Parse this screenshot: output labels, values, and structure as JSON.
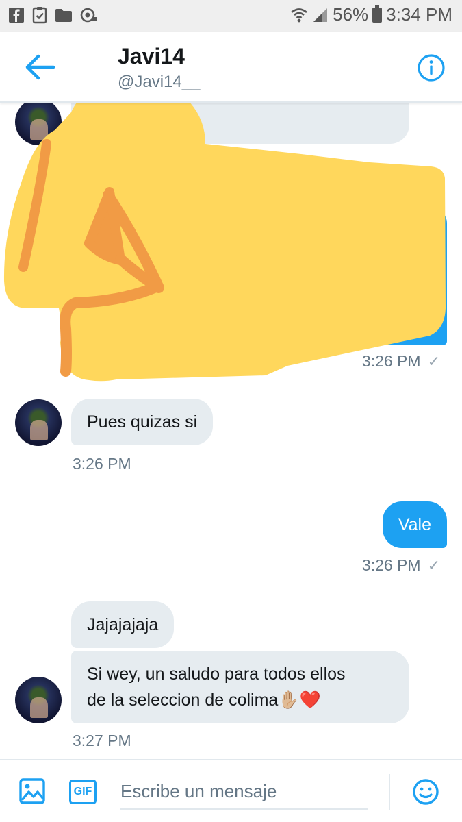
{
  "status_bar": {
    "battery": "56%",
    "time": "3:34 PM",
    "left_icons": [
      "facebook-icon",
      "clipboard-check-icon",
      "folder-icon",
      "sync-icon"
    ],
    "right_icons": [
      "wifi-icon",
      "signal-icon",
      "battery-icon"
    ]
  },
  "header": {
    "name": "Javi14",
    "handle": "@Javi14__",
    "back_icon": "arrow-left-icon",
    "info_icon": "info-icon",
    "accent": "#1da1f2"
  },
  "messages": {
    "sent_time_1": "3:26 PM",
    "received_1": "Pues quizas si",
    "received_time_1": "3:26 PM",
    "sent_2": "Vale",
    "sent_time_2": "3:26 PM",
    "received_2": "Jajajajaja",
    "received_3_line1": "Si wey, un saludo para todos ellos",
    "received_3_line2": "de la seleccion de colima",
    "received_3_emoji": "✋🏼❤️",
    "received_time_3": "3:27 PM"
  },
  "composer": {
    "placeholder": "Escribe un mensaje",
    "image_icon": "image-icon",
    "gif_label": "GIF",
    "emoji_icon": "smiley-icon"
  },
  "overlay": {
    "icon": "fist-emoji-icon",
    "color": "#ffd75c"
  }
}
